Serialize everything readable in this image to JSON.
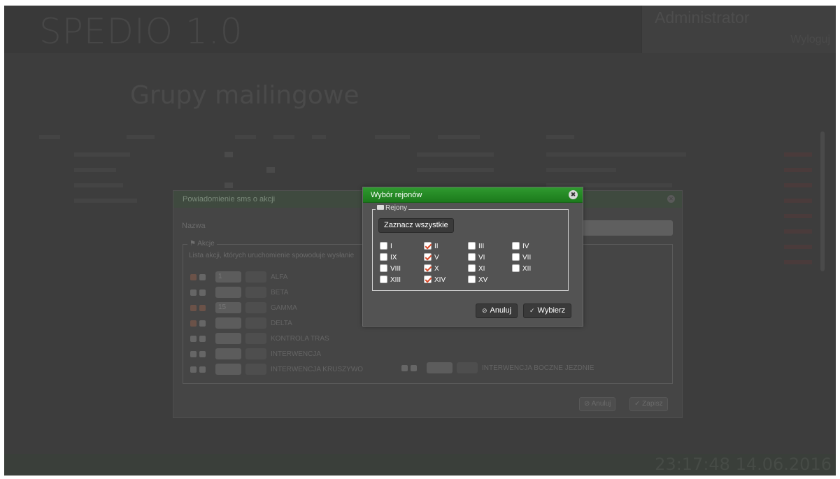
{
  "app": {
    "brand": "SPEDIO 1.0",
    "user_name": "Administrator",
    "logout": "Wyloguj",
    "page_title": "Grupy mailingowe",
    "clock": "23:17:48  14.06.2016"
  },
  "sms_dialog": {
    "title": "Powiadomienie sms o akcji",
    "name_label": "Nazwa",
    "legend": "Akcje",
    "description": "Lista akcji, których uruchomienie spowoduje wysłanie",
    "actions": [
      {
        "label": "ALFA",
        "value": "1",
        "cb1": true,
        "cb2": false
      },
      {
        "label": "BETA",
        "value": "",
        "cb1": false,
        "cb2": false
      },
      {
        "label": "GAMMA",
        "value": "15",
        "cb1": true,
        "cb2": true
      },
      {
        "label": "DELTA",
        "value": "",
        "cb1": true,
        "cb2": false
      },
      {
        "label": "KONTROLA TRAS",
        "value": "",
        "cb1": false,
        "cb2": false
      },
      {
        "label": "INTERWENCJA",
        "value": "",
        "cb1": false,
        "cb2": false
      },
      {
        "label": "INTERWENCJA KRUSZYWO",
        "value": "",
        "cb1": false,
        "cb2": false
      }
    ],
    "extra_action": "INTERWENCJA BOCZNE JEZDNIE",
    "cancel_label": "Anuluj",
    "save_label": "Zapisz"
  },
  "region_dialog": {
    "title": "Wybór rejonów",
    "legend": "Rejony",
    "select_all": "Zaznacz wszystkie",
    "regions": [
      {
        "label": "I",
        "checked": false
      },
      {
        "label": "II",
        "checked": true
      },
      {
        "label": "III",
        "checked": false
      },
      {
        "label": "IV",
        "checked": false
      },
      {
        "label": "IX",
        "checked": false
      },
      {
        "label": "V",
        "checked": true
      },
      {
        "label": "VI",
        "checked": false
      },
      {
        "label": "VII",
        "checked": false
      },
      {
        "label": "VIII",
        "checked": false
      },
      {
        "label": "X",
        "checked": true
      },
      {
        "label": "XI",
        "checked": false
      },
      {
        "label": "XII",
        "checked": false
      },
      {
        "label": "XIII",
        "checked": false
      },
      {
        "label": "XIV",
        "checked": true
      },
      {
        "label": "XV",
        "checked": false
      }
    ],
    "cancel_label": "Anuluj",
    "confirm_label": "Wybierz"
  },
  "colors": {
    "header_green": "#1c7a1c",
    "check_mark": "#d94a2a"
  }
}
